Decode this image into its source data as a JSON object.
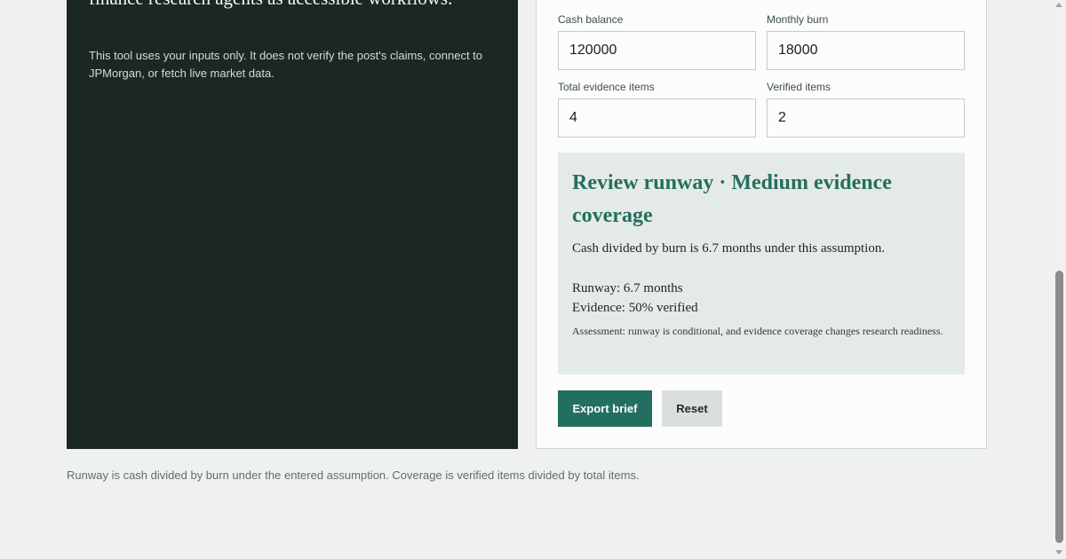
{
  "left_panel": {
    "heading_line1": "finance research agents as accessible workflows.",
    "disclaimer": "This tool uses your inputs only. It does not verify the post's claims, connect to JPMorgan, or fetch live market data."
  },
  "inputs": {
    "cash_balance": {
      "label": "Cash balance",
      "value": "120000"
    },
    "monthly_burn": {
      "label": "Monthly burn",
      "value": "18000"
    },
    "total_evidence": {
      "label": "Total evidence items",
      "value": "4"
    },
    "verified_items": {
      "label": "Verified items",
      "value": "2"
    }
  },
  "result": {
    "title": "Review runway · Medium evidence coverage",
    "description": "Cash divided by burn is 6.7 months under this assumption.",
    "runway": "Runway: 6.7 months",
    "evidence": "Evidence: 50% verified",
    "assessment": "Assessment: runway is conditional, and evidence coverage changes research readiness."
  },
  "buttons": {
    "export": "Export brief",
    "reset": "Reset"
  },
  "footer": {
    "note": "Runway is cash divided by burn under the entered assumption. Coverage is verified items divided by total items."
  },
  "colors": {
    "accent": "#236f5f",
    "dark_panel": "#1b2724",
    "result_bg": "#e4ebe7"
  }
}
